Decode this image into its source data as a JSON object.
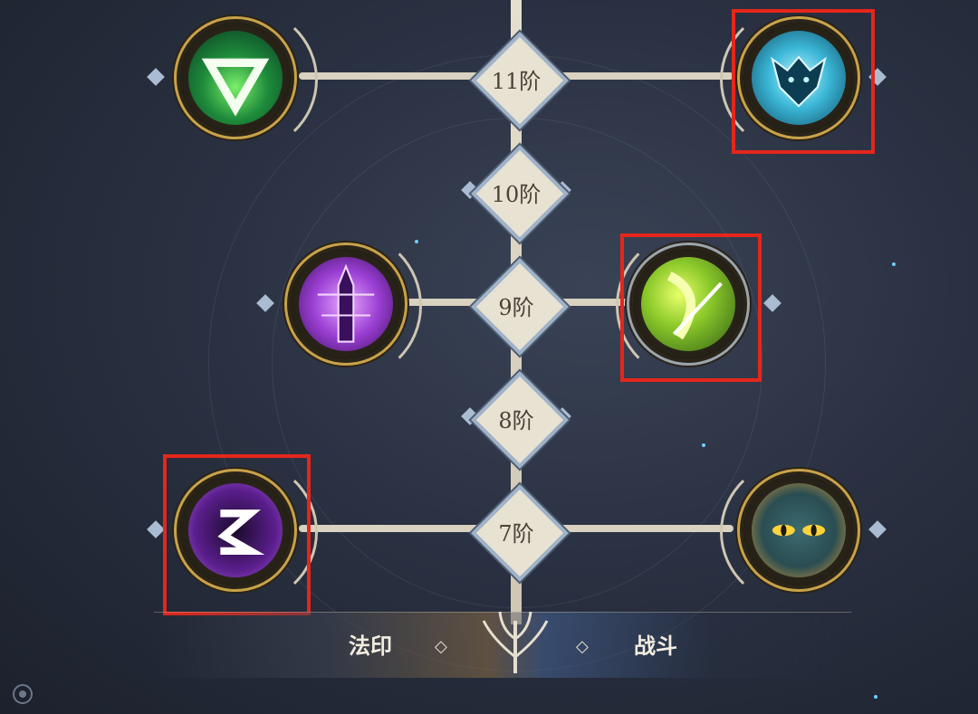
{
  "tree": {
    "tiers": [
      {
        "label": "11阶"
      },
      {
        "label": "10阶"
      },
      {
        "label": "9阶"
      },
      {
        "label": "8阶"
      },
      {
        "label": "7阶"
      }
    ],
    "skills": [
      {
        "name": "triangle-sign-skill",
        "color": "#2fbf5a"
      },
      {
        "name": "wolf-head-skill",
        "color": "#39b7d9"
      },
      {
        "name": "purple-blade-skill",
        "color": "#a45ad8"
      },
      {
        "name": "green-slash-skill",
        "color": "#9acb2a"
      },
      {
        "name": "purple-s-rune-skill",
        "color": "#8a3ec9"
      },
      {
        "name": "cat-eyes-skill",
        "color": "#e0a13a"
      }
    ]
  },
  "footer": {
    "left_tab": "法印",
    "right_tab": "战斗",
    "left_arrow": "◇",
    "right_arrow": "◇"
  },
  "colors": {
    "highlight": "#e5261b",
    "frame_gold": "#c8a24a",
    "tier_fill": "#e8e2d3"
  }
}
